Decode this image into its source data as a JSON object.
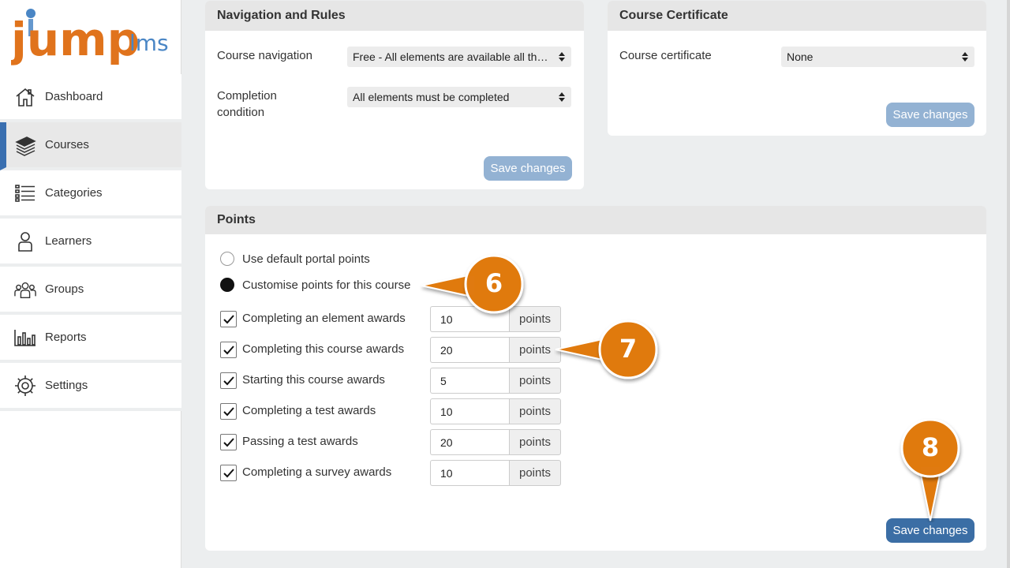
{
  "app": {
    "logo_main": "jump",
    "logo_sub": "lms"
  },
  "sidebar": {
    "items": [
      {
        "label": "Dashboard",
        "icon": "home-icon"
      },
      {
        "label": "Courses",
        "icon": "books-icon",
        "active": true
      },
      {
        "label": "Categories",
        "icon": "list-icon"
      },
      {
        "label": "Learners",
        "icon": "person-icon"
      },
      {
        "label": "Groups",
        "icon": "group-icon"
      },
      {
        "label": "Reports",
        "icon": "bar-chart-icon"
      },
      {
        "label": "Settings",
        "icon": "gear-icon"
      }
    ]
  },
  "navigation_rules": {
    "title": "Navigation and Rules",
    "course_navigation_label": "Course navigation",
    "course_navigation_value": "Free - All elements are available all the time",
    "completion_condition_label": "Completion condition",
    "completion_condition_value": "All elements must be completed",
    "save_label": "Save changes"
  },
  "certificate": {
    "title": "Course Certificate",
    "label": "Course certificate",
    "value": "None",
    "save_label": "Save changes"
  },
  "points": {
    "title": "Points",
    "radio_default": "Use default portal points",
    "radio_custom": "Customise points for this course",
    "unit": "points",
    "rows": [
      {
        "label": "Completing an element awards",
        "value": "10"
      },
      {
        "label": "Completing this course awards",
        "value": "20"
      },
      {
        "label": "Starting this course awards",
        "value": "5"
      },
      {
        "label": "Completing a test awards",
        "value": "10"
      },
      {
        "label": "Passing a test awards",
        "value": "20"
      },
      {
        "label": "Completing a survey awards",
        "value": "10"
      }
    ],
    "save_label": "Save changes"
  },
  "callouts": [
    "6",
    "7",
    "8"
  ],
  "colors": {
    "accent": "#3b6ea5",
    "callout": "#e07a10",
    "logo_orange": "#e0731c",
    "logo_blue": "#4a86c5"
  }
}
